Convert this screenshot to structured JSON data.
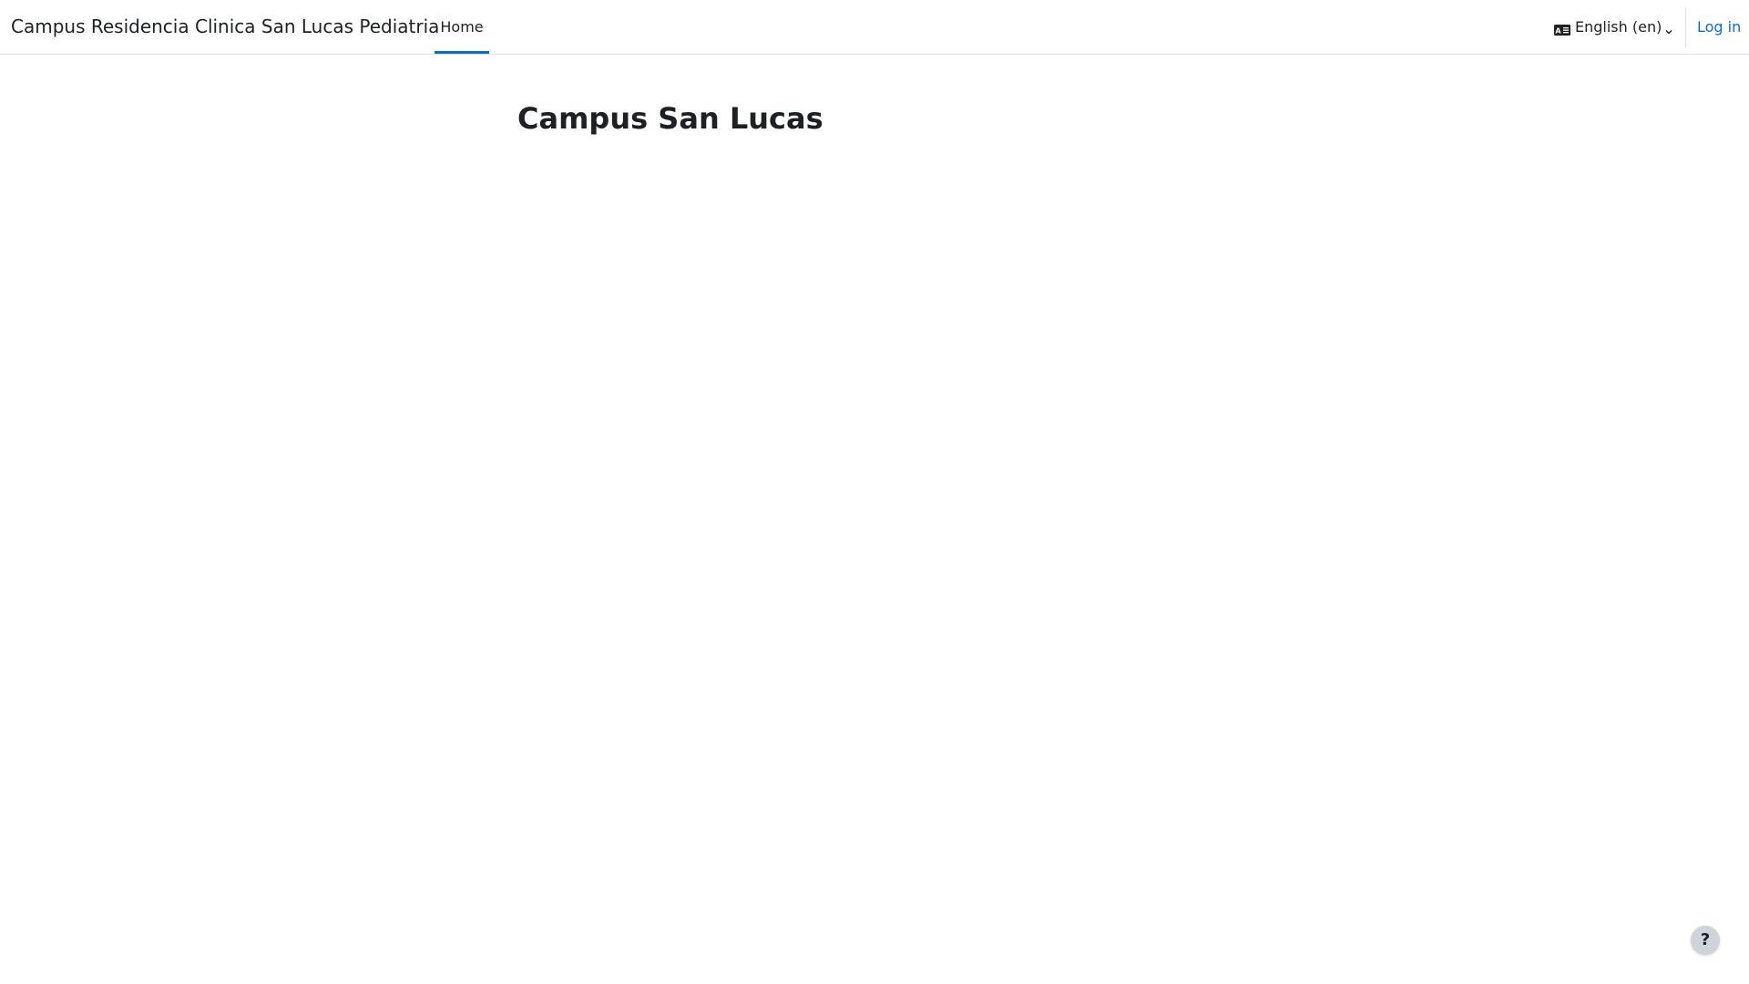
{
  "navbar": {
    "brand": "Campus Residencia Clinica San Lucas Pediatria",
    "home_label": "Home",
    "language_label": "English (en)",
    "language_icon": "language-icon",
    "login_label": "Log in"
  },
  "main": {
    "title": "Campus San Lucas"
  },
  "help": {
    "label": "?"
  },
  "colors": {
    "accent": "#0f6cbf",
    "text": "#1d2125",
    "border": "#dee2e6",
    "help_bg": "#ced4da"
  }
}
